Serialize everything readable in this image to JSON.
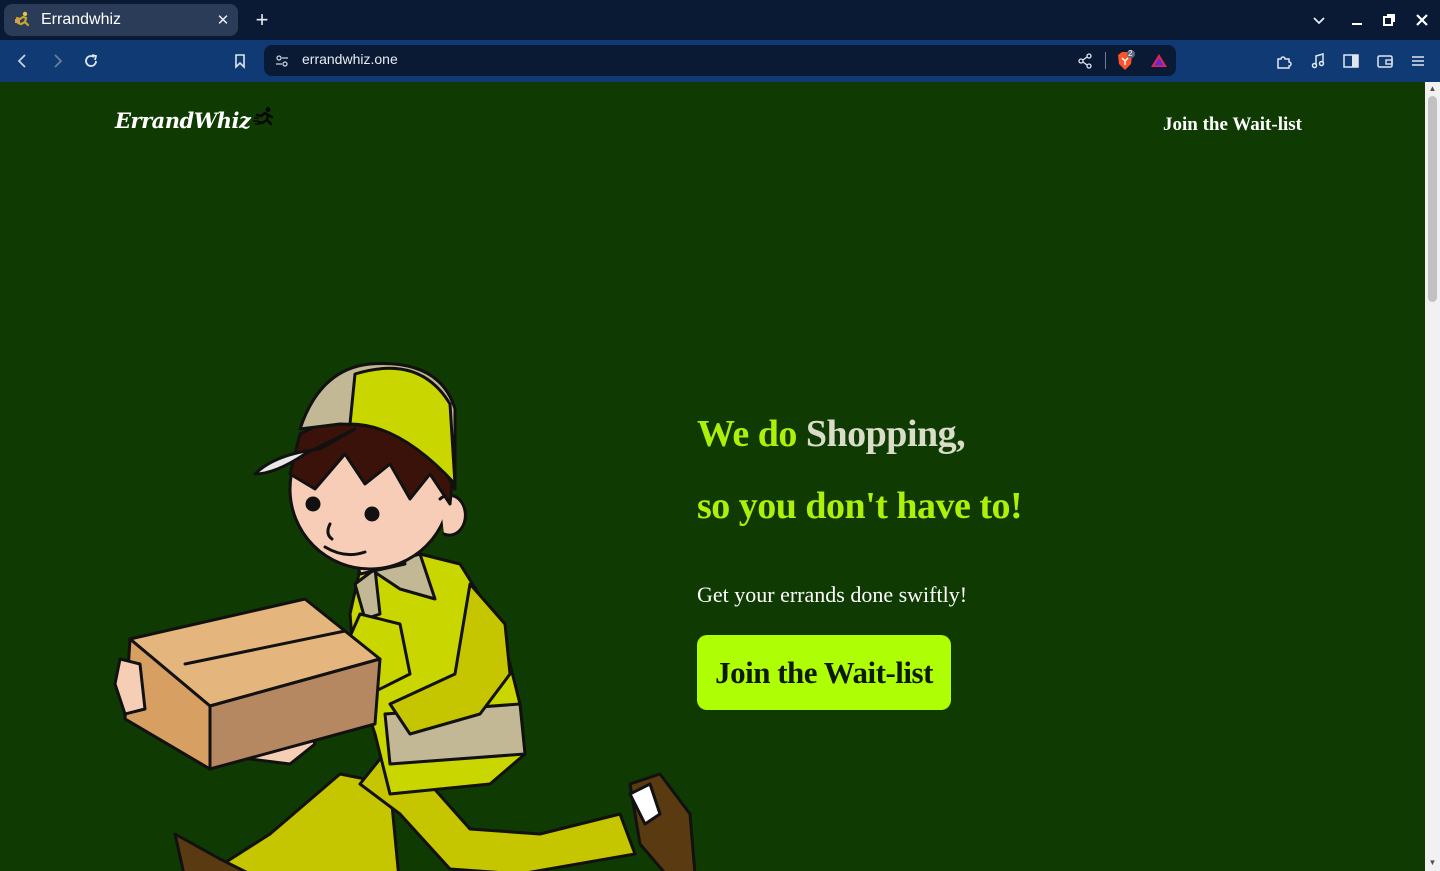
{
  "browser": {
    "tab": {
      "title": "Errandwhiz",
      "favicon": "runner-icon"
    },
    "window_controls": [
      "tab-list-icon",
      "minimize-icon",
      "restore-icon",
      "close-icon"
    ],
    "address": {
      "url": "errandwhiz.one",
      "shields_count": "2"
    }
  },
  "site": {
    "logo": {
      "text": "ErrandWhiz",
      "icon": "runner-icon"
    },
    "nav": {
      "join": "Join the Wait-list"
    },
    "hero": {
      "headline_part1": "We do ",
      "headline_part2": "Shopping,",
      "headline_line2": "so you don't have to!",
      "tagline": "Get your errands done swiftly!",
      "cta": "Join the Wait-list"
    }
  },
  "colors": {
    "page_bg": "#0f3a02",
    "accent_lime": "#aef00a",
    "cta_bg": "#aeff06",
    "chrome_tab_bar": "#0a1a34",
    "chrome_toolbar": "#0f3a73"
  }
}
